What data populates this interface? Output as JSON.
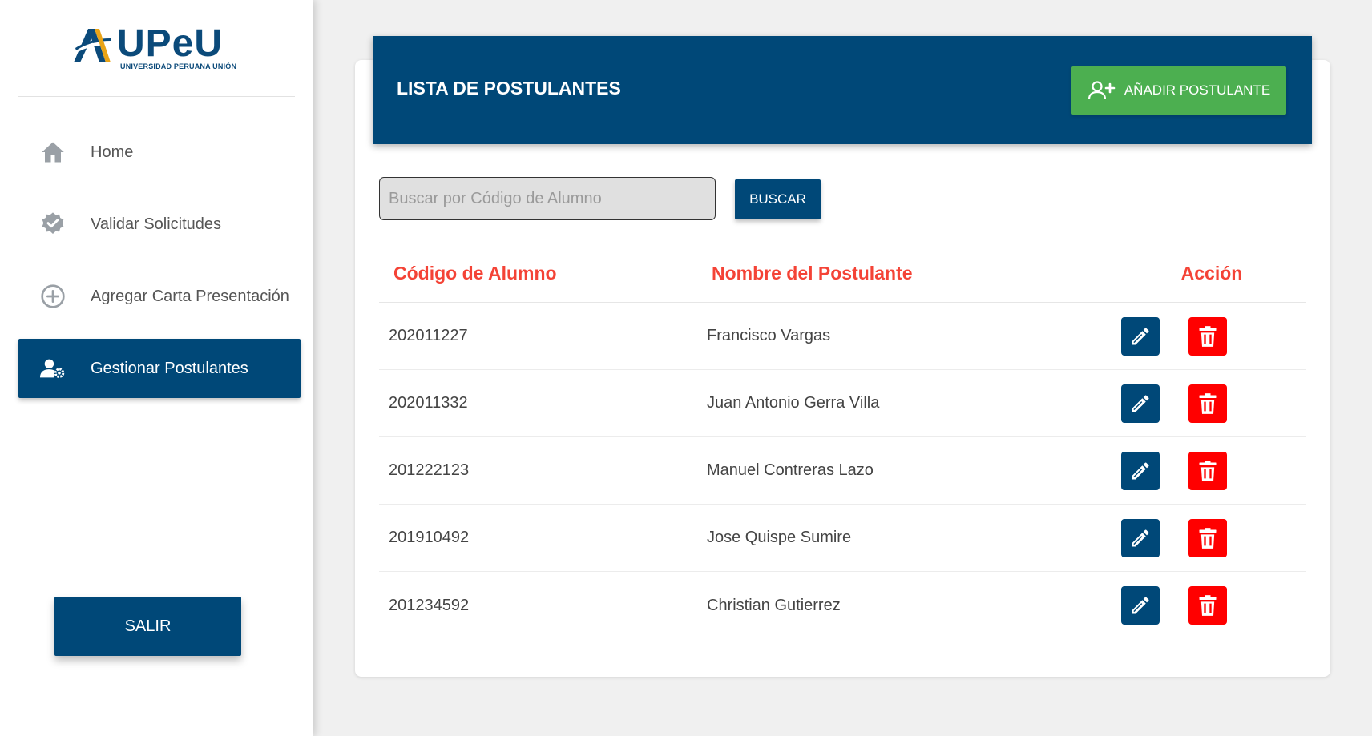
{
  "logo": {
    "name": "UPeU",
    "subtitle": "UNIVERSIDAD PERUANA UNIÓN"
  },
  "sidebar": {
    "items": [
      {
        "label": "Home",
        "icon": "home-icon",
        "active": false
      },
      {
        "label": "Validar Solicitudes",
        "icon": "verified-badge-icon",
        "active": false
      },
      {
        "label": "Agregar Carta Presentación",
        "icon": "add-circle-icon",
        "active": false
      },
      {
        "label": "Gestionar Postulantes",
        "icon": "user-gear-icon",
        "active": true
      }
    ],
    "logout_label": "SALIR"
  },
  "header": {
    "title": "LISTA DE POSTULANTES",
    "add_button_label": "AÑADIR POSTULANTE"
  },
  "search": {
    "placeholder": "Buscar por Código de Alumno",
    "value": "",
    "button_label": "BUSCAR"
  },
  "table": {
    "columns": [
      "Código de Alumno",
      "Nombre del Postulante",
      "Acción"
    ],
    "rows": [
      {
        "code": "202011227",
        "name": "Francisco Vargas"
      },
      {
        "code": "202011332",
        "name": "Juan Antonio Gerra Villa"
      },
      {
        "code": "201222123",
        "name": "Manuel Contreras Lazo"
      },
      {
        "code": "201910492",
        "name": "Jose Quispe Sumire"
      },
      {
        "code": "201234592",
        "name": "Christian Gutierrez"
      }
    ]
  },
  "colors": {
    "primary": "#004878",
    "success": "#4caf50",
    "danger": "#ff0000",
    "header_text": "#f44336"
  }
}
